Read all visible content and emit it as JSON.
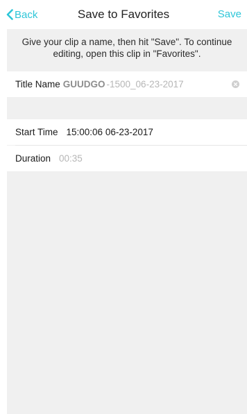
{
  "nav": {
    "back_label": "Back",
    "title": "Save to Favorites",
    "save_label": "Save"
  },
  "hint": {
    "line1": "Give your clip a name, then hit \"Save\". To continue",
    "line2": "editing, open this clip in \"Favorites\"."
  },
  "title_row": {
    "label": "Title Name",
    "value_bold": "GUUDGO",
    "value_rest": "-1500_06-23-2017"
  },
  "start_row": {
    "label": "Start Time",
    "value": "15:00:06 06-23-2017"
  },
  "duration_row": {
    "label": "Duration",
    "value": "00:35"
  },
  "icons": {
    "back": "chevron-left-icon",
    "clear": "clear-icon"
  },
  "colors": {
    "accent": "#2ec6d8",
    "background": "#f0f0f0",
    "placeholder": "#b6b6b6"
  }
}
